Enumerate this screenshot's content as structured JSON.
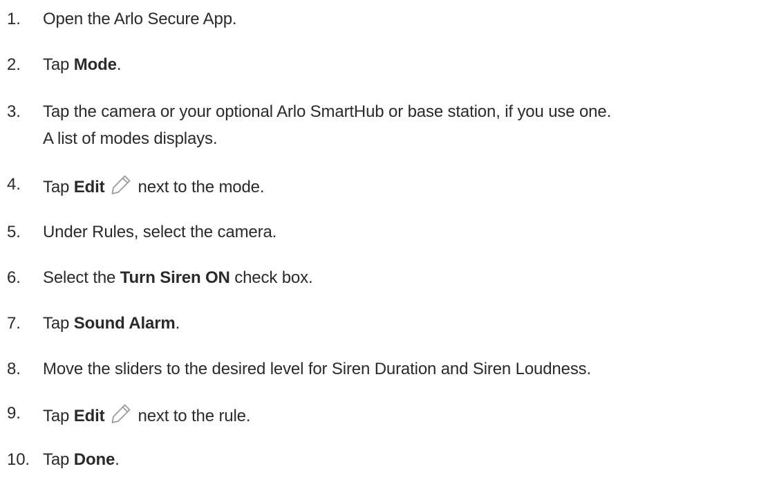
{
  "steps": [
    {
      "number": "1.",
      "parts": [
        {
          "text": "Open the Arlo Secure App."
        }
      ]
    },
    {
      "number": "2.",
      "parts": [
        {
          "text": "Tap "
        },
        {
          "text": "Mode",
          "bold": true
        },
        {
          "text": "."
        }
      ]
    },
    {
      "number": "3.",
      "parts": [
        {
          "text": "Tap the camera or your optional Arlo SmartHub or base station, if you use one."
        }
      ],
      "continuation": "A list of modes displays."
    },
    {
      "number": "4.",
      "parts": [
        {
          "text": "Tap "
        },
        {
          "text": "Edit",
          "bold": true
        },
        {
          "icon": "pencil-icon"
        },
        {
          "text": "next to the mode."
        }
      ]
    },
    {
      "number": "5.",
      "parts": [
        {
          "text": "Under Rules, select the camera."
        }
      ]
    },
    {
      "number": "6.",
      "parts": [
        {
          "text": "Select the "
        },
        {
          "text": "Turn Siren ON",
          "bold": true
        },
        {
          "text": " check box."
        }
      ]
    },
    {
      "number": "7.",
      "parts": [
        {
          "text": "Tap "
        },
        {
          "text": "Sound Alarm",
          "bold": true
        },
        {
          "text": "."
        }
      ]
    },
    {
      "number": "8.",
      "parts": [
        {
          "text": "Move the sliders to the desired level for Siren Duration and Siren Loudness."
        }
      ]
    },
    {
      "number": "9.",
      "parts": [
        {
          "text": "Tap "
        },
        {
          "text": "Edit",
          "bold": true
        },
        {
          "icon": "pencil-icon"
        },
        {
          "text": "next to the rule."
        }
      ]
    },
    {
      "number": "10.",
      "parts": [
        {
          "text": "Tap "
        },
        {
          "text": "Done",
          "bold": true
        },
        {
          "text": "."
        }
      ]
    }
  ]
}
